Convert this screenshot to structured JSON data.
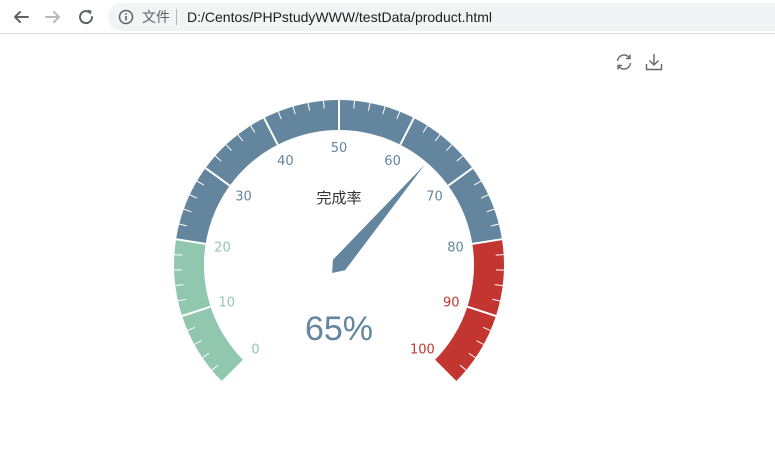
{
  "browser": {
    "scheme_label": "文件",
    "url": "D:/Centos/PHPstudyWWW/testData/product.html"
  },
  "icons": {
    "back": "arrow-left-icon",
    "forward": "arrow-right-icon",
    "reload": "reload-icon",
    "info": "info-icon",
    "restore": "restore-icon",
    "save_image": "download-icon"
  },
  "chart_data": {
    "type": "gauge",
    "series": [
      {
        "name": "完成率",
        "value": 65,
        "detail": "65%"
      }
    ],
    "min": 0,
    "max": 100,
    "split_number": 10,
    "axis_labels": [
      "0",
      "10",
      "20",
      "30",
      "40",
      "50",
      "60",
      "70",
      "80",
      "90",
      "100"
    ],
    "color_bands": [
      {
        "to": 0.2,
        "color": "#91c7ae"
      },
      {
        "to": 0.8,
        "color": "#63869e"
      },
      {
        "to": 1.0,
        "color": "#c23531"
      }
    ],
    "detail_color": "#63869e",
    "title_color": "#333333"
  }
}
